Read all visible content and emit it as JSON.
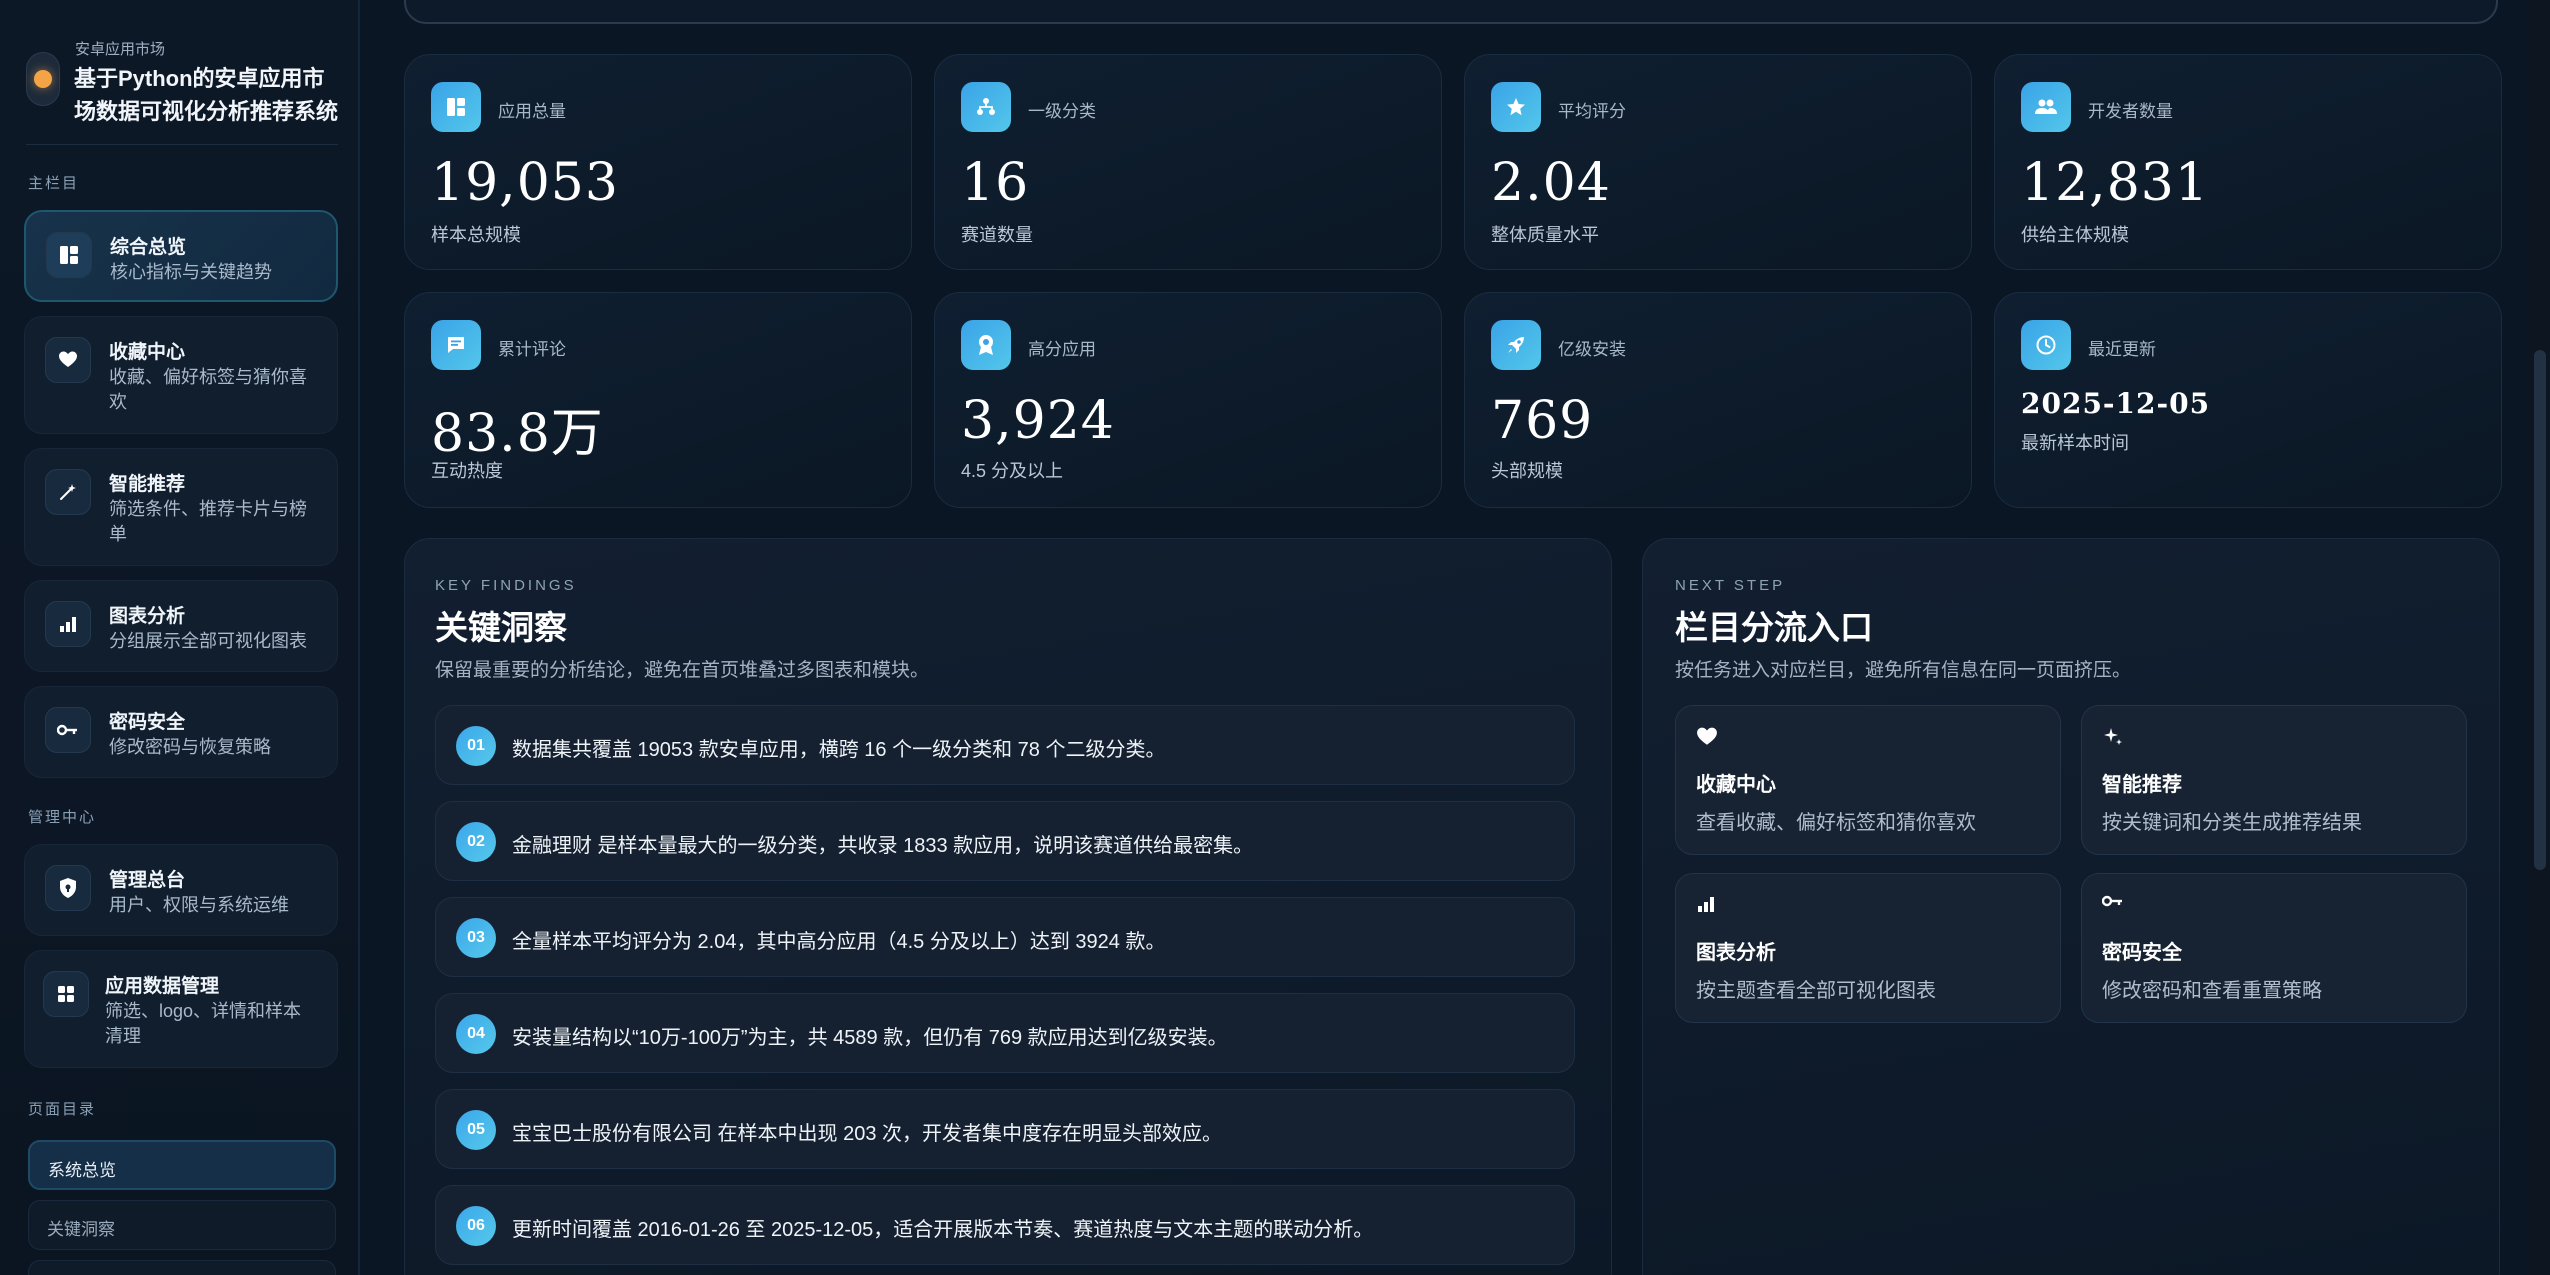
{
  "brand": {
    "subtitle": "安卓应用市场",
    "title": "基于Python的安卓应用市场数据可视化分析推荐系统"
  },
  "sidebar": {
    "main_section": "主栏目",
    "main_items": [
      {
        "title": "综合总览",
        "desc": "核心指标与关键趋势",
        "icon": "dashboard-icon",
        "active": true
      },
      {
        "title": "收藏中心",
        "desc": "收藏、偏好标签与猜你喜欢",
        "icon": "heart-icon"
      },
      {
        "title": "智能推荐",
        "desc": "筛选条件、推荐卡片与榜单",
        "icon": "magic-wand-icon"
      },
      {
        "title": "图表分析",
        "desc": "分组展示全部可视化图表",
        "icon": "bar-chart-icon"
      },
      {
        "title": "密码安全",
        "desc": "修改密码与恢复策略",
        "icon": "key-icon"
      }
    ],
    "admin_section": "管理中心",
    "admin_items": [
      {
        "title": "管理总台",
        "desc": "用户、权限与系统运维",
        "icon": "shield-icon"
      },
      {
        "title": "应用数据管理",
        "desc": "筛选、logo、详情和样本清理",
        "icon": "grid-icon"
      }
    ],
    "toc_section": "页面目录",
    "toc_items": [
      {
        "label": "系统总览",
        "active": true
      },
      {
        "label": "关键洞察"
      }
    ]
  },
  "stats": [
    {
      "label": "应用总量",
      "value": "19,053",
      "caption": "样本总规模",
      "icon": "dashboard-icon"
    },
    {
      "label": "一级分类",
      "value": "16",
      "caption": "赛道数量",
      "icon": "hierarchy-icon"
    },
    {
      "label": "平均评分",
      "value": "2.04",
      "caption": "整体质量水平",
      "icon": "star-icon"
    },
    {
      "label": "开发者数量",
      "value": "12,831",
      "caption": "供给主体规模",
      "icon": "users-icon"
    },
    {
      "label": "累计评论",
      "value": "83.8万",
      "caption": "互动热度",
      "icon": "comment-icon"
    },
    {
      "label": "高分应用",
      "value": "3,924",
      "caption": "4.5 分及以上",
      "icon": "badge-icon"
    },
    {
      "label": "亿级安装",
      "value": "769",
      "caption": "头部规模",
      "icon": "rocket-icon"
    },
    {
      "label": "最近更新",
      "value": "2025-12-05",
      "caption": "最新样本时间",
      "icon": "clock-icon"
    }
  ],
  "findings": {
    "eyebrow": "KEY FINDINGS",
    "title": "关键洞察",
    "desc": "保留最重要的分析结论，避免在首页堆叠过多图表和模块。",
    "items": [
      {
        "num": "01",
        "text": "数据集共覆盖 19053 款安卓应用，横跨 16 个一级分类和 78 个二级分类。"
      },
      {
        "num": "02",
        "text": "金融理财 是样本量最大的一级分类，共收录 1833 款应用，说明该赛道供给最密集。"
      },
      {
        "num": "03",
        "text": "全量样本平均评分为 2.04，其中高分应用（4.5 分及以上）达到 3924 款。"
      },
      {
        "num": "04",
        "text": "安装量结构以“10万-100万”为主，共 4589 款，但仍有 769 款应用达到亿级安装。"
      },
      {
        "num": "05",
        "text": "宝宝巴士股份有限公司 在样本中出现 203 次，开发者集中度存在明显头部效应。"
      },
      {
        "num": "06",
        "text": "更新时间覆盖 2016-01-26 至 2025-12-05，适合开展版本节奏、赛道热度与文本主题的联动分析。"
      }
    ]
  },
  "next_step": {
    "eyebrow": "NEXT STEP",
    "title": "栏目分流入口",
    "desc": "按任务进入对应栏目，避免所有信息在同一页面挤压。",
    "cards": [
      {
        "title": "收藏中心",
        "desc": "查看收藏、偏好标签和猜你喜欢",
        "icon": "heart-icon"
      },
      {
        "title": "智能推荐",
        "desc": "按关键词和分类生成推荐结果",
        "icon": "sparkle-icon"
      },
      {
        "title": "图表分析",
        "desc": "按主题查看全部可视化图表",
        "icon": "bar-chart-icon"
      },
      {
        "title": "密码安全",
        "desc": "修改密码和查看重置策略",
        "icon": "key-icon"
      }
    ]
  },
  "colors": {
    "accent": "#3aa7ea",
    "brand_dot": "#f4a347",
    "background": "#0a1624"
  }
}
